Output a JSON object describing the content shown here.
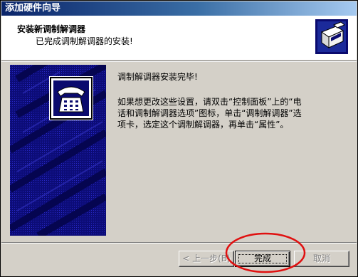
{
  "window": {
    "title": "添加硬件向导"
  },
  "header": {
    "title": "安装新调制解调器",
    "subtitle": "已完成调制解调器的安装!",
    "icon": "hardware-wizard-icon"
  },
  "content": {
    "illustration": "telephone-modem-icon",
    "message_line1": "调制解调器安装完毕!",
    "message_line2": "如果想更改这些设置，请双击“控制面板”上的“电话和调制解调器选项”图标，单击“调制解调器”选项卡，选定这个调制解调器，再单击“属性”。"
  },
  "buttons": {
    "back": "< 上一步(B)",
    "finish": "完成",
    "cancel": "取消"
  },
  "colors": {
    "titlebar_start": "#0a246a",
    "titlebar_end": "#a6caf0",
    "art_blue": "#0a0a6e",
    "annotation_red": "#e01010"
  }
}
